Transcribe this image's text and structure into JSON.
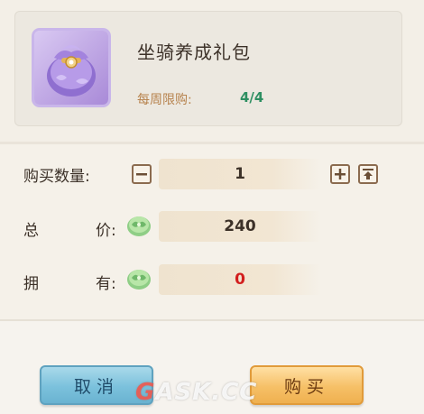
{
  "item": {
    "name": "坐骑养成礼包",
    "icon": "purple-gift-bag-icon",
    "weekly_limit_label": "每周限购:",
    "weekly_limit_value": "4/4"
  },
  "form": {
    "quantity_label": "购买数量:",
    "quantity_value": "1",
    "total_label_a": "总",
    "total_label_b": "价:",
    "total_value": "240",
    "owned_label_a": "拥",
    "owned_label_b": "有:",
    "owned_value": "0"
  },
  "buttons": {
    "cancel": "取消",
    "buy": "购买"
  },
  "watermark": {
    "part1": "G",
    "part2": "ASK.CC"
  },
  "colors": {
    "limit_value": "#2e8f62",
    "owned_value": "#d21e1e",
    "cancel_bg": "#7bc1dc",
    "buy_bg": "#f6c067"
  }
}
